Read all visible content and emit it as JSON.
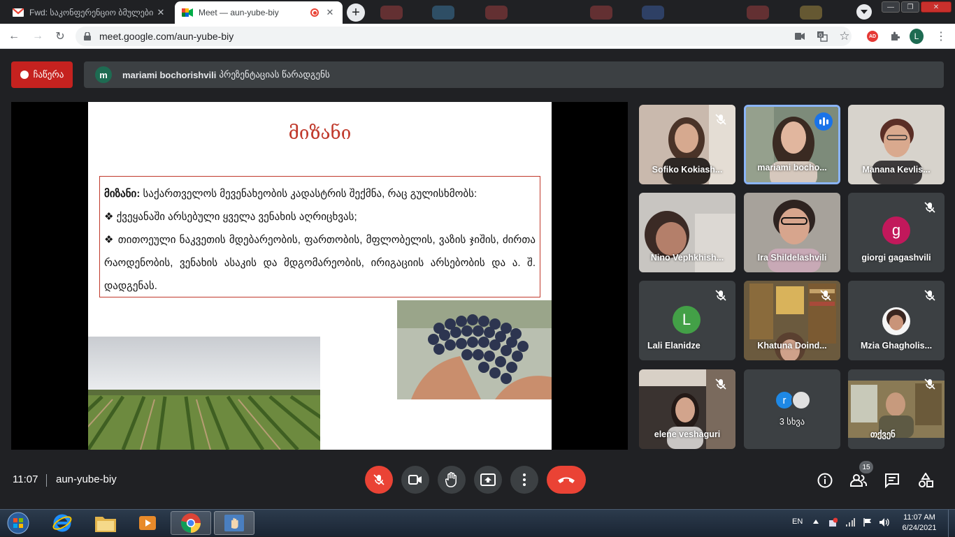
{
  "browser": {
    "tabs": [
      {
        "title": "Fwd: საკონფერენციო ბმულები",
        "favicon": "gmail-icon",
        "active": false
      },
      {
        "title": "Meet — aun-yube-biy",
        "favicon": "meet-icon",
        "active": true
      }
    ],
    "new_tab_label": "+",
    "url": "meet.google.com/aun-yube-biy",
    "profile_initial": "L"
  },
  "meet": {
    "record_label": "ჩაწერა",
    "presenter": {
      "initial": "m",
      "name": "mariami bochorishvili",
      "action": "პრეზენტაციას წარადგენს"
    },
    "slide": {
      "title": "მიზანი",
      "lead_bold": "მიზანი:",
      "lead_text": " საქართველოს მევენახეობის კადასტრის შექმნა, რაც გულისხმობს:",
      "bullet1": "❖ ქვეყანაში არსებული ყველა ვენახის აღრიცხვას;",
      "bullet2": "❖ თითოეული ნაკვეთის მდებარეობის, ფართობის, მფლობელის, ვაზის ჯიშის, ძირთა რაოდენობის, ვენახის ასაკის და მდგომარეობის, ირიგაციის არსებობის და ა. შ. დადგენას."
    },
    "participants": [
      {
        "name": "Sofiko Kokiash...",
        "muted": true,
        "video": true
      },
      {
        "name": "mariami bocho...",
        "muted": false,
        "video": true,
        "speaking": true
      },
      {
        "name": "Manana Kevlis...",
        "muted": false,
        "video": true
      },
      {
        "name": "Nino Vephkhish...",
        "muted": false,
        "video": true
      },
      {
        "name": "Ira Shildelashvili",
        "muted": false,
        "video": true
      },
      {
        "name": "giorgi gagashvili",
        "muted": true,
        "video": false,
        "initial": "g",
        "color": "#c2185b"
      },
      {
        "name": "Lali Elanidze",
        "muted": true,
        "video": false,
        "initial": "L",
        "color": "#43a047"
      },
      {
        "name": "Khatuna Doind...",
        "muted": true,
        "video": true
      },
      {
        "name": "Mzia Ghagholis...",
        "muted": true,
        "video": false
      },
      {
        "name": "elene veshaguri",
        "muted": true,
        "video": true
      },
      {
        "name": "3 სხვა",
        "others": true,
        "initial": "r"
      },
      {
        "name": "თქვენ",
        "muted": true,
        "video": true
      }
    ],
    "clock": "11:07",
    "meeting_code": "aun-yube-biy",
    "people_count": "15"
  },
  "taskbar": {
    "language": "EN",
    "time": "11:07 AM",
    "date": "6/24/2021"
  },
  "colors": {
    "accent_red": "#ea4335",
    "meet_bg": "#202124",
    "tile_bg": "#3c4043",
    "speaking_blue": "#1a73e8",
    "slide_title": "#c0392b"
  }
}
